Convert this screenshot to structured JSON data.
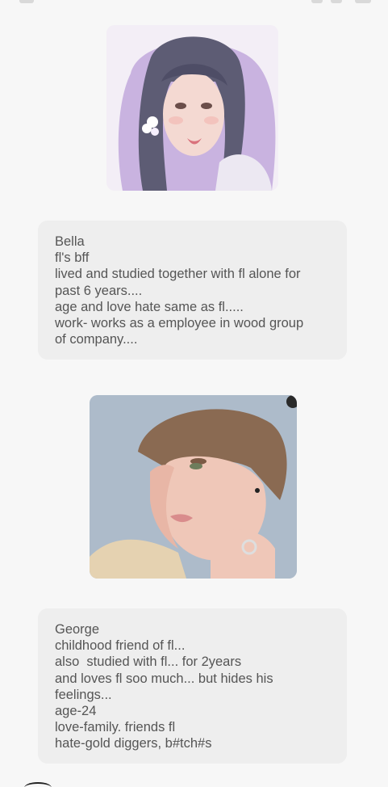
{
  "messages": [
    {
      "character": "Bella",
      "avatar_icon": "portrait-illustration-woman",
      "lines": [
        "Bella",
        "fl's bff",
        "lived and studied together with fl alone for",
        "past 6 years....",
        "age and love hate same as fl.....",
        "work- works as a employee in wood group",
        "of company...."
      ]
    },
    {
      "character": "George",
      "avatar_icon": "portrait-illustration-man",
      "lines": [
        "George",
        "childhood friend of fl...",
        "also  studied with fl... for 2years",
        "and loves fl soo much... but hides his",
        "feelings...",
        "age-24",
        "love-family. friends fl",
        "hate-gold diggers, b#tch#s"
      ]
    }
  ],
  "colors": {
    "background": "#f7f7f7",
    "bubble": "#eeeeee",
    "text": "#555555"
  }
}
